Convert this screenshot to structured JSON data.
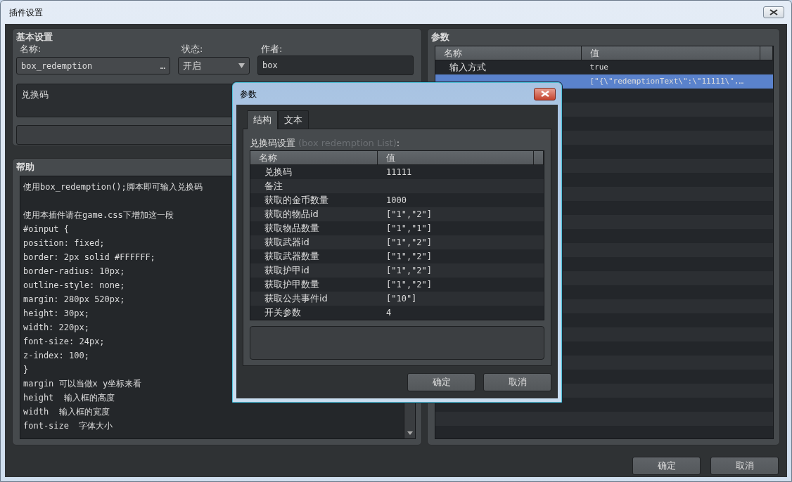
{
  "window": {
    "title": "插件设置"
  },
  "basic": {
    "title": "基本设置",
    "name_label": "名称:",
    "name_value": "box_redemption",
    "name_button": "…",
    "status_label": "状态:",
    "status_value": "开启",
    "author_label": "作者:",
    "author_value": "box",
    "description": "兑换码"
  },
  "help": {
    "title": "帮助",
    "paragraphs": [
      [
        "使用box_redemption();脚本即可输入兑换码"
      ],
      [
        "使用本插件请在game.css下增加这一段",
        "#oinput {",
        "position: fixed;",
        "border: 2px solid #FFFFFF;",
        "border-radius: 10px;",
        "outline-style: none;",
        "margin: 280px 520px;",
        "height: 30px;",
        "width: 220px;",
        "font-size: 24px;",
        "z-index: 100;",
        "}",
        "margin 可以当做x y坐标来看",
        "height  输入框的高度",
        "width  输入框的宽度",
        "font-size  字体大小"
      ]
    ]
  },
  "params": {
    "title": "参数",
    "columns": [
      "名称",
      "值"
    ],
    "rows": [
      {
        "name": "输入方式",
        "value": "true",
        "selected": false
      },
      {
        "value": "[\"{\\\"redemptionText\\\":\\\"11111\\\",…",
        "selected": true
      }
    ]
  },
  "buttons": [
    "确定",
    "取消"
  ],
  "dialog": {
    "title": "参数",
    "tabs": [
      {
        "label": "结构",
        "selected": true
      },
      {
        "label": "文本",
        "selected": false
      }
    ],
    "caption": "兑换码设置",
    "caption_hint": "(box redemption List)",
    "caption_suffix": ":",
    "columns": [
      "名称",
      "值"
    ],
    "rows": [
      {
        "name": "兑换码",
        "value": "11111"
      },
      {
        "name": "备注"
      },
      {
        "name": "获取的金币数量",
        "value": "1000"
      },
      {
        "name": "获取的物品id",
        "value": "[\"1\",\"2\"]"
      },
      {
        "name": "获取物品数量",
        "value": "[\"1\",\"1\"]"
      },
      {
        "name": "获取武器id",
        "value": "[\"1\",\"2\"]"
      },
      {
        "name": "获取武器数量",
        "value": "[\"1\",\"2\"]"
      },
      {
        "name": "获取护甲id",
        "value": "[\"1\",\"2\"]"
      },
      {
        "name": "获取护甲数量",
        "value": "[\"1\",\"2\"]"
      },
      {
        "name": "获取公共事件id",
        "value": "[\"10\"]"
      },
      {
        "name": "开关参数",
        "value": "4"
      }
    ],
    "buttons": [
      "确定",
      "取消"
    ]
  }
}
